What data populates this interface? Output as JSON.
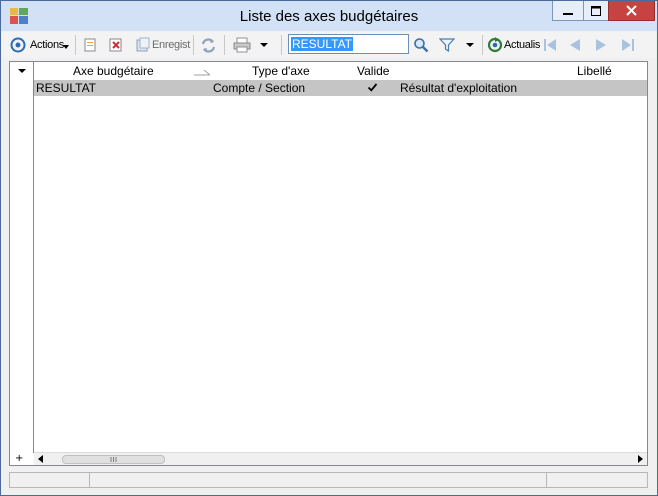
{
  "window": {
    "title": "Liste des axes budgétaires"
  },
  "toolbar": {
    "actions_label": "Actions",
    "save_label": "Enregist",
    "search_value": "RESULTAT",
    "refresh_label": "Actualis"
  },
  "grid": {
    "columns": [
      "Axe budgétaire",
      "Type d'axe",
      "Valide",
      "Libellé"
    ],
    "rows": [
      {
        "axe": "RESULTAT",
        "type": "Compte / Section",
        "valide": true,
        "libelle": "Résultat d'exploitation"
      }
    ],
    "add_row_symbol": "+"
  },
  "colors": {
    "titlebar": "#d2e1f5",
    "close_button": "#c74343",
    "selected_row": "#c5c5c5",
    "search_highlight": "#3399ff"
  },
  "icons": [
    "app-icon",
    "minimize-icon",
    "maximize-icon",
    "close-icon",
    "actions-icon",
    "dropdown-arrow-icon",
    "new-record-icon",
    "delete-icon",
    "save-icon",
    "sync-icon",
    "print-icon",
    "magnifier-icon",
    "filter-icon",
    "refresh-icon",
    "first-page-icon",
    "previous-page-icon",
    "next-page-icon",
    "last-page-icon",
    "checkmark-icon",
    "scroll-left-icon",
    "scroll-right-icon"
  ]
}
